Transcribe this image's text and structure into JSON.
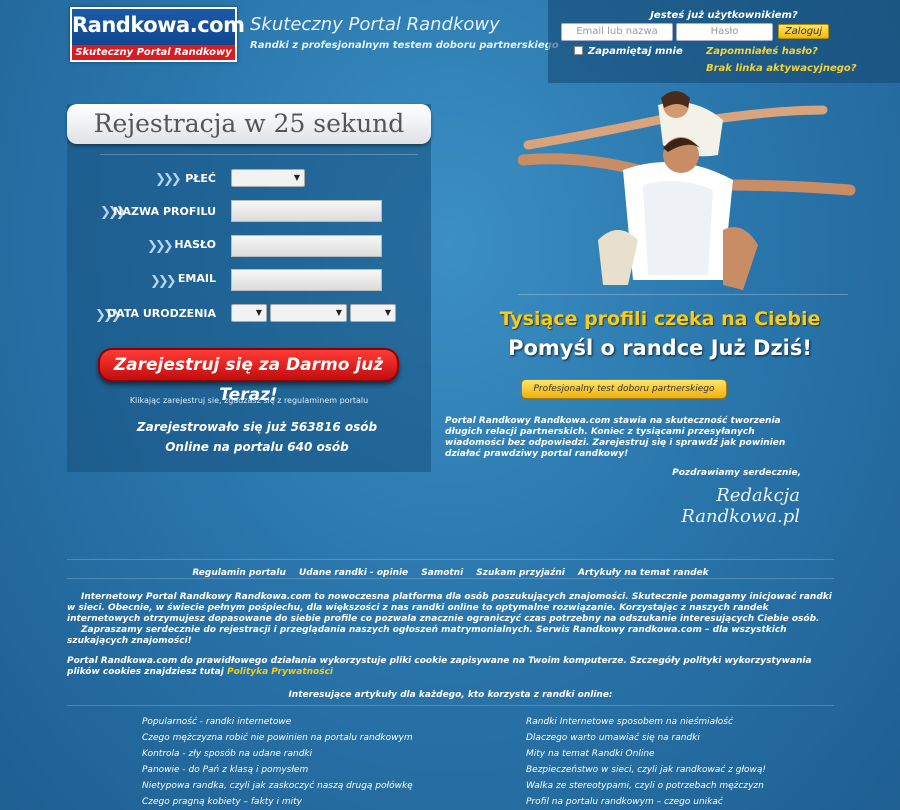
{
  "header": {
    "logo_main": "Randkowa.com",
    "logo_sub": "Skuteczny Portal Randkowy",
    "tagline": "Skuteczny Portal Randkowy",
    "subtagline": "Randki z profesjonalnym testem doboru partnerskiego"
  },
  "login": {
    "question": "Jesteś już użytkownikiem?",
    "email_placeholder": "Email lub nazwa",
    "password_placeholder": "Hasło",
    "submit": "Zaloguj",
    "remember": "Zapamiętaj mnie",
    "forgot": "Zapomniałeś hasło?",
    "no_activation": "Brak linka aktywacyjnego?"
  },
  "registration": {
    "title": "Rejestracja w 25 sekund",
    "gender_label": "PŁEĆ",
    "profile_label": "NAZWA PROFILU",
    "password_label": "HASŁO",
    "email_label": "EMAIL",
    "dob_label": "DATA URODZENIA",
    "button": "Zarejestruj się za Darmo już Teraz!",
    "terms": "Klikając zarejestruj sie, zgadzasz się z regulaminem portalu",
    "registered": "Zarejestrowało się już 563816 osób",
    "online": "Online na portalu 640 osób"
  },
  "promo": {
    "line1": "Tysiące profili czeka na Ciebie",
    "line2": "Pomyśl o randce Już Dziś!",
    "test_button": "Profesjonalny test doboru partnerskiego",
    "description": "Portal Randkowy Randkowa.com stawia na skuteczność tworzenia długich relacji partnerskich. Koniec z tysiącami przesyłanych wiadomości bez odpowiedzi. Zarejestruj się i sprawdź jak powinien działać prawdziwy portal randkowy!",
    "greeting": "Pozdrawiamy serdecznie,",
    "signature": "Redakcja Randkowa.pl"
  },
  "nav": {
    "items": [
      "Regulamin portalu",
      "Udane randki - opinie",
      "Samotni",
      "Szukam przyjaźni",
      "Artykuły na temat randek"
    ]
  },
  "about": {
    "p1": "Internetowy Portal Randkowy Randkowa.com to nowoczesna platforma dla osób poszukujących znajomości. Skutecznie pomagamy inicjować randki w sieci. Obecnie, w świecie pełnym pośpiechu, dla większości z nas randki online to optymalne rozwiązanie. Korzystając z naszych randek internetowych otrzymujesz dopasowane do siebie profile co pozwala znacznie ograniczyć czas potrzebny na odszukanie interesujących Ciebie osób.",
    "p2": "Zapraszamy serdecznie do rejestracji i przeglądania naszych ogłoszeń matrymonialnych. Serwis Randkowy randkowa.com – dla wszystkich szukających znajomości!"
  },
  "cookie": {
    "text": "Portal Randkowa.com do prawidłowego działania wykorzystuje pliki cookie zapisywane na Twoim komputerze. Szczegóły polityki wykorzystywania plików cookies znajdziesz tutaj",
    "link": "Polityka Prywatności"
  },
  "articles": {
    "title": "Interesujące artykuły dla każdego, kto korzysta z randki online:",
    "left": [
      "Popularność - randki internetowe",
      "Czego mężczyzna robić nie powinien na portalu randkowym",
      "Kontrola - zły sposób na udane randki",
      "Panowie - do Pań z klasą i pomysłem",
      "Nietypowa randka, czyli jak zaskoczyć naszą drugą połówkę",
      "Czego pragną kobiety – fakty i mity"
    ],
    "right": [
      "Randki Internetowe sposobem na nieśmiałość",
      "Dlaczego warto umawiać się na randki",
      "Mity na temat Randki Online",
      "Bezpieczeństwo w sieci, czyli jak randkować z głową!",
      "Walka ze stereotypami, czyli o potrzebach mężczyzn",
      "Profil na portalu randkowym – czego unikać"
    ]
  }
}
